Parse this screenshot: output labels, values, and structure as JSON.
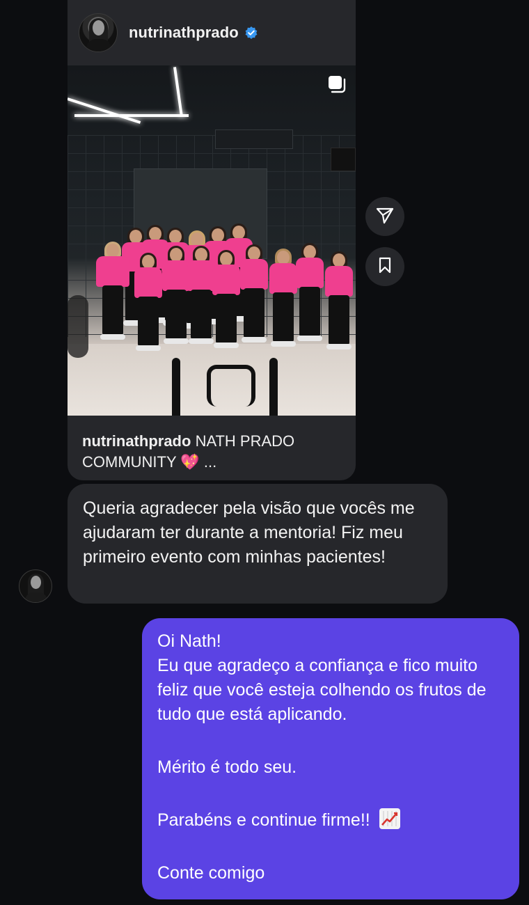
{
  "post": {
    "username": "nutrinathprado",
    "verified": true,
    "image_alt_icon": "multiple-posts-icon",
    "caption_user": "nutrinathprado",
    "caption_text": "NATH PRADO",
    "caption_line2": "COMMUNITY",
    "caption_emoji": "💖",
    "caption_more": "..."
  },
  "side_actions": {
    "share_icon": "share-icon",
    "save_icon": "bookmark-icon"
  },
  "incoming": {
    "text": "Queria agradecer pela visão que vocês me ajudaram ter durante a mentoria! Fiz meu primeiro evento com minhas pacientes!"
  },
  "outgoing": {
    "line1": "Oi Nath!",
    "line2": "Eu que agradeço a confiança e fico muito feliz que você esteja colhendo os frutos de tudo que está aplicando.",
    "line3": "Mérito é todo seu.",
    "line4": "Parabéns e continue firme!!",
    "line4_emoji_icon": "chart-increasing-icon",
    "line5": "Conte comigo"
  },
  "colors": {
    "background": "#0c0d10",
    "bubble_in": "#26272b",
    "bubble_out": "#5b43e4",
    "verified_blue": "#3897f0",
    "shirt_pink": "#ef3f8f"
  }
}
